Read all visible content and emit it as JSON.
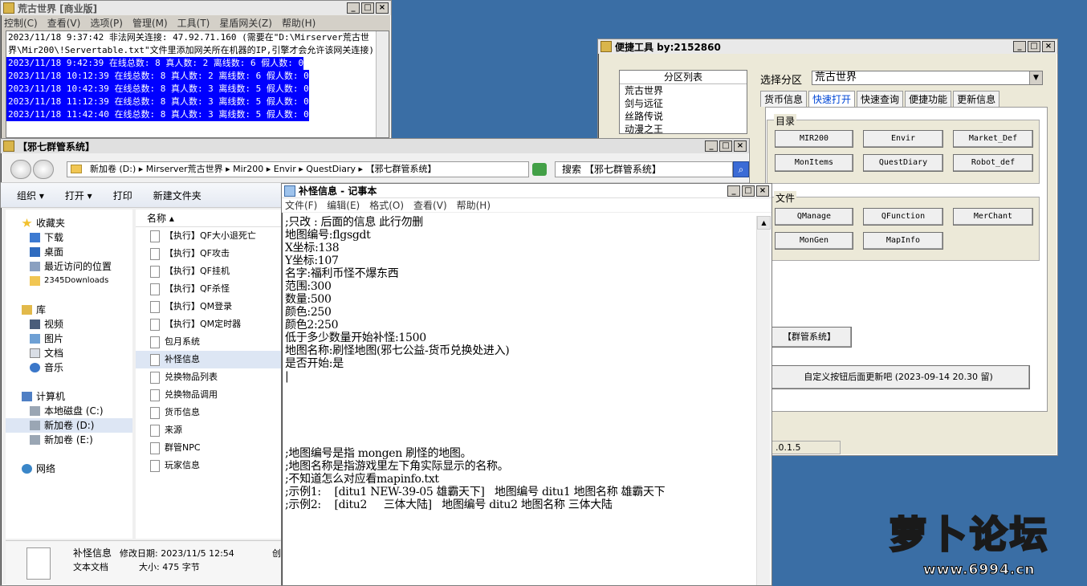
{
  "w1": {
    "title": "荒古世界 [商业版]",
    "menu": [
      "控制(C)",
      "查看(V)",
      "选项(P)",
      "管理(M)",
      "工具(T)",
      "星盾网关(Z)",
      "帮助(H)"
    ],
    "log_note": "2023/11/18 9:37:42 非法网关连接: 47.92.71.160 (需要在\"D:\\Mirserver荒古世界\\Mir200\\!Servertable.txt\"文件里添加网关所在机器的IP,引擎才会允许该网关连接)",
    "log_lines": [
      "2023/11/18 9:42:39 在线总数: 8 真人数: 2 离线数: 6 假人数: 0",
      "2023/11/18 10:12:39 在线总数: 8 真人数: 2 离线数: 6 假人数: 0",
      "2023/11/18 10:42:39 在线总数: 8 真人数: 3 离线数: 5 假人数: 0",
      "2023/11/18 11:12:39 在线总数: 8 真人数: 3 离线数: 5 假人数: 0",
      "2023/11/18 11:42:40 在线总数: 8 真人数: 3 离线数: 5 假人数: 0"
    ]
  },
  "w2": {
    "title": "便捷工具   by:2152860",
    "list_header": "分区列表",
    "list_items": [
      "荒古世界",
      "剑与远征",
      "丝路传说",
      "动漫之王"
    ],
    "select_label": "选择分区",
    "select_value": "荒古世界",
    "tabs": [
      "货币信息",
      "快速打开",
      "快速查询",
      "便捷功能",
      "更新信息"
    ],
    "group1_label": "目录",
    "group1_buttons": [
      "MIR200",
      "Envir",
      "Market_Def",
      "MonItems",
      "QuestDiary",
      "Robot_def"
    ],
    "group2_label": "文件",
    "group2_buttons": [
      "QManage",
      "QFunction",
      "MerChant",
      "MonGen",
      "MapInfo"
    ],
    "btn_group_sys": "【群管系统】",
    "btn_custom": "自定义按钮后面更新吧 (2023-09-14 20.30 留)",
    "version": ".0.1.5"
  },
  "w3": {
    "title": "【邪七群管系统】",
    "breadcrumb": "新加卷 (D:) ▸ Mirserver荒古世界 ▸ Mir200 ▸ Envir ▸ QuestDiary ▸ 【邪七群管系统】",
    "search_placeholder": "搜索 【邪七群管系统】",
    "toolbar": [
      "组织 ▾",
      "打开 ▾",
      "打印",
      "新建文件夹"
    ],
    "nav": {
      "favorites": "收藏夹",
      "downloads": "下载",
      "desktop": "桌面",
      "recent": "最近访问的位置",
      "d2345": "2345Downloads",
      "library": "库",
      "video": "视频",
      "pictures": "图片",
      "documents": "文档",
      "music": "音乐",
      "computer": "计算机",
      "drive_c": "本地磁盘 (C:)",
      "drive_d": "新加卷 (D:)",
      "drive_e": "新加卷 (E:)",
      "network": "网络"
    },
    "column_name": "名称",
    "files": [
      "【执行】QF大小退死亡",
      "【执行】QF攻击",
      "【执行】QF挂机",
      "【执行】QF杀怪",
      "【执行】QM登录",
      "【执行】QM定时器",
      "包月系统",
      "补怪信息",
      "兑换物品列表",
      "兑换物品调用",
      "货币信息",
      "来源",
      "群管NPC",
      "玩家信息"
    ],
    "selected_file_index": 7,
    "details": {
      "name": "补怪信息",
      "modified": "修改日期: 2023/11/5 12:54",
      "type": "文本文档",
      "size": "大小: 475 字节",
      "created_prefix": "创"
    }
  },
  "w4": {
    "title": "补怪信息 - 记事本",
    "menu": [
      "文件(F)",
      "编辑(E)",
      "格式(O)",
      "查看(V)",
      "帮助(H)"
    ],
    "content": ";只改 : 后面的信息 此行勿删\n地图编号:flgsgdt\nX坐标:138\nY坐标:107\n名字:福利币怪不爆东西\n范围:300\n数量:500\n颜色:250\n颜色2:250\n低于多少数量开始补怪:1500\n地图名称:刷怪地图(邪七公益-货币兑换处进入)\n是否开始:是\n|\n\n\n\n\n\n;地图编号是指 mongen 刷怪的地图。\n;地图名称是指游戏里左下角实际显示的名称。\n;不知道怎么对应看mapinfo.txt\n;示例1:    [ditu1 NEW-39-05 雄霸天下]   地图编号 ditu1 地图名称 雄霸天下\n;示例2:    [ditu2     三体大陆]   地图编号 ditu2 地图名称 三体大陆"
  },
  "watermark": {
    "logo_text": "萝卜论坛",
    "url": "www.6994.cn"
  }
}
